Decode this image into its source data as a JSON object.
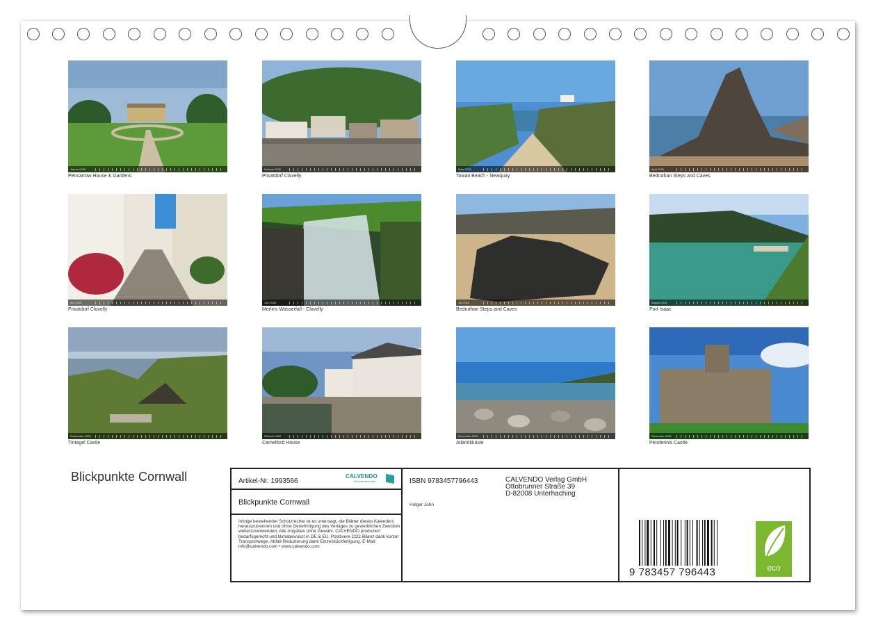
{
  "calendar": {
    "title": "Blickpunkte Cornwall",
    "months": [
      {
        "month": "Januar 2026",
        "caption": "Pencarrow House & Gardens"
      },
      {
        "month": "Februar 2026",
        "caption": "Privatdorf Clovelly"
      },
      {
        "month": "März 2026",
        "caption": "Towan Beach - Newquay"
      },
      {
        "month": "April 2026",
        "caption": "Bedruthan Steps and Caves"
      },
      {
        "month": "Mai 2026",
        "caption": "Privatdorf Clovelly"
      },
      {
        "month": "Juni 2026",
        "caption": "Merlins Wasserfall - Clovelly"
      },
      {
        "month": "Juli 2026",
        "caption": "Bedruthan Steps and Caves"
      },
      {
        "month": "August 2026",
        "caption": "Port Isaac"
      },
      {
        "month": "September 2026",
        "caption": "Tintagel Castle"
      },
      {
        "month": "Oktober 2026",
        "caption": "Camelford House"
      },
      {
        "month": "November 2026",
        "caption": "Atlantikküste"
      },
      {
        "month": "Dezember 2026",
        "caption": "Pendennis Castle"
      }
    ]
  },
  "info": {
    "artikel": "Artikel-Nr. 1993566",
    "logo_text": "CALVENDO",
    "logo_sub": "Ihre Kalendermarke",
    "title": "Blickpunkte Cornwall",
    "legal": "Infolge bestehender Schutzrechte ist es untersagt, die Blätter dieses Kalenders herauszutrennen und ohne Genehmigung des Verlages zu gewerblichen Zwecken weiterzuverwenden. Alle Angaben ohne Gewähr. CALVENDO produziert bedarfsgerecht und klimabewusst in DE & EU. Positivere CO2-Bilanz dank kurzer Transportwege. Abfall-Reduzierung dank Einzelstückfertigung. E-Mail: info@calvendo.com • www.calvendo.com",
    "isbn": "ISBN 9783457796443",
    "author": "Holger John",
    "publisher_lines": [
      "CALVENDO Verlag GmbH",
      "Ottobrunner Straße 39",
      "D-82008 Unterhaching"
    ],
    "barcode_number": "9 783457 796443",
    "eco_label": "eco"
  },
  "colors": {
    "frame": "#222222",
    "eco_green": "#7cb82f",
    "calvendo_teal": "#1a8a8a"
  }
}
